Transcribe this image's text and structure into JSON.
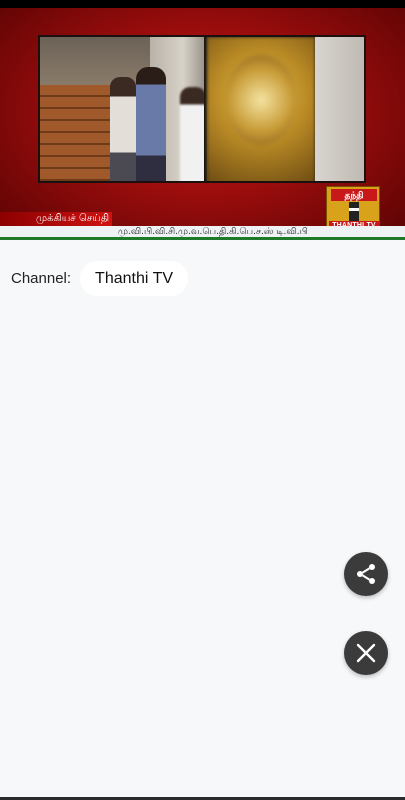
{
  "video": {
    "ticker_label": "முக்கியச் செய்தி",
    "ticker_text": "மு.வி.பி.வி.சி.மு.வ.பெ.தி.கி.பெ.ச.ஸ் டி.வி.பி",
    "logo_tamil": "தந்தி",
    "logo_brand": "THANTHI TV"
  },
  "channel": {
    "label": "Channel:",
    "value": "Thanthi TV"
  },
  "actions": {
    "share_icon": "share-icon",
    "close_icon": "close-icon"
  },
  "colors": {
    "background": "#f7f8fa",
    "fab": "#3b3b3b",
    "broadcast_red": "#c81a1a",
    "ticker_green": "#1e7a2a"
  }
}
